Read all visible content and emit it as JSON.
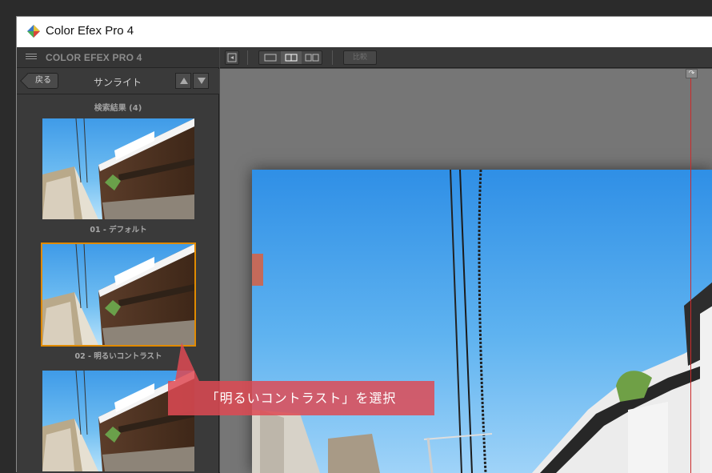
{
  "window": {
    "title": "Color Efex Pro 4"
  },
  "sidebar": {
    "header_title": "COLOR EFEX PRO 4",
    "back_label": "戻る",
    "filter_title": "サンライト",
    "results_label": "検索結果 (4)",
    "presets": [
      {
        "caption": "01 - デフォルト",
        "selected": false
      },
      {
        "caption": "02 - 明るいコントラスト",
        "selected": true
      },
      {
        "caption": "",
        "selected": false
      }
    ]
  },
  "toolbar": {
    "compare_label": "比較"
  },
  "annotation": {
    "text": "「明るいコントラスト」を選択"
  },
  "colors": {
    "selection": "#e08a00",
    "split_line": "#cc2b2b",
    "annotation_bg": "#de4a54"
  }
}
